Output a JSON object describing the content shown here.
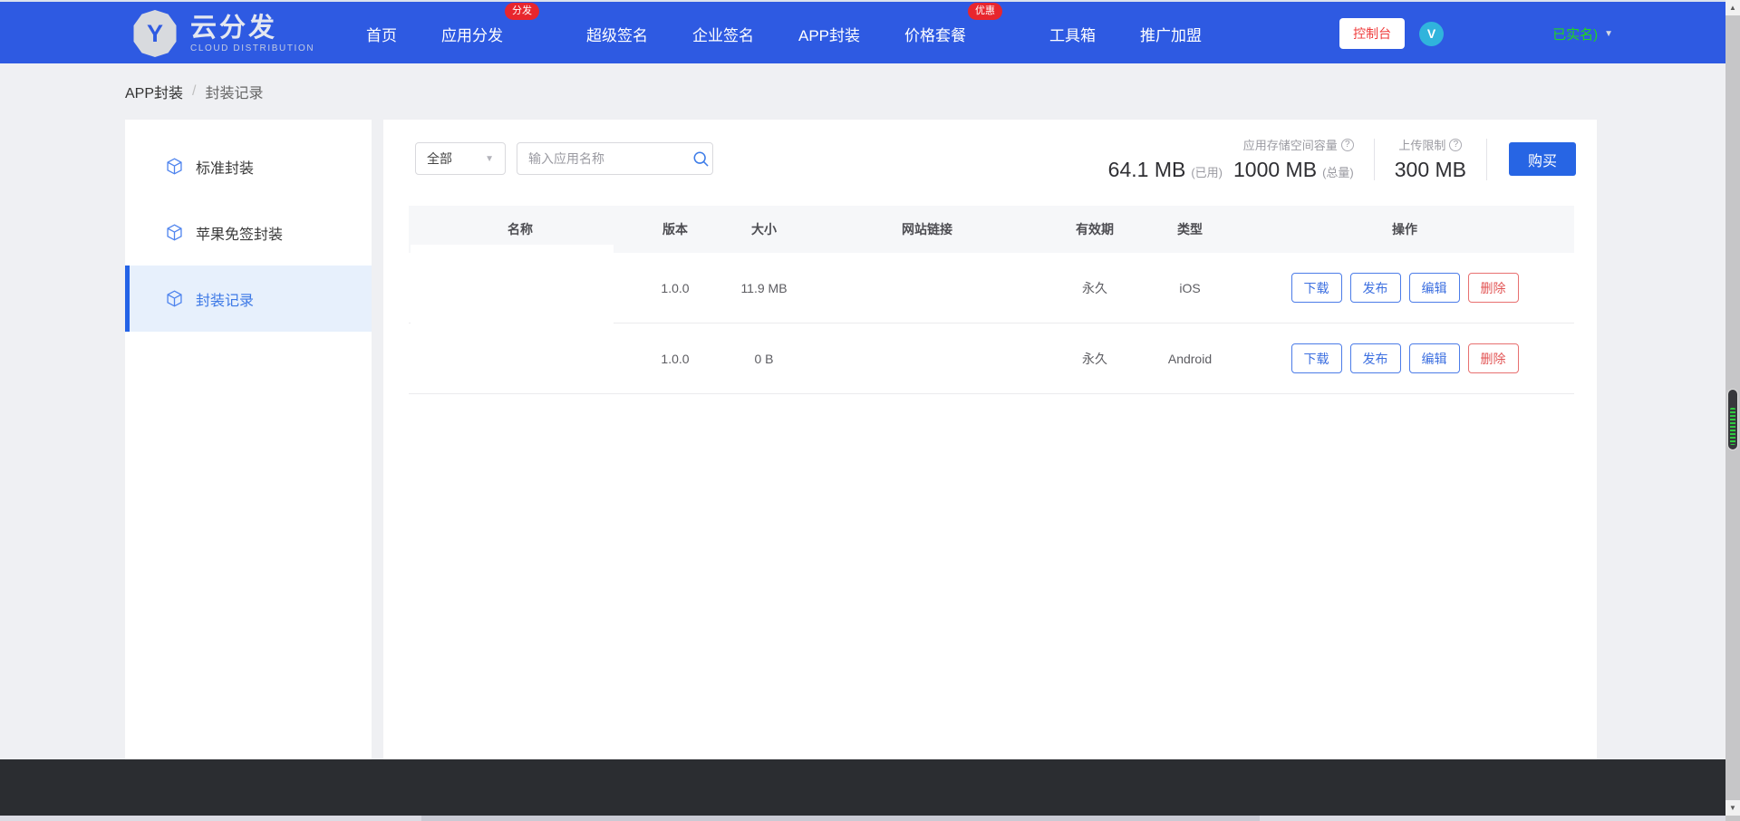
{
  "nav": {
    "logo": {
      "letter": "Y",
      "title": "云分发",
      "subtitle": "CLOUD DISTRIBUTION"
    },
    "items": [
      {
        "label": "首页"
      },
      {
        "label": "应用分发",
        "badge": "分发"
      },
      {
        "label": "超级签名"
      },
      {
        "label": "企业签名"
      },
      {
        "label": "APP封装"
      },
      {
        "label": "价格套餐",
        "badge": "优惠"
      },
      {
        "label": "工具箱"
      },
      {
        "label": "推广加盟"
      }
    ],
    "console_button": "控制台",
    "avatar_letter": "V",
    "account_status": "已实名)",
    "account_caret": "▼"
  },
  "breadcrumb": {
    "section": "APP封装",
    "separator": "/",
    "current": "封装记录"
  },
  "sidebar": {
    "items": [
      {
        "label": "标准封装"
      },
      {
        "label": "苹果免签封装"
      },
      {
        "label": "封装记录"
      }
    ]
  },
  "toolbar": {
    "filter_value": "全部",
    "filter_caret": "▼",
    "search_placeholder": "输入应用名称"
  },
  "storage": {
    "capacity_label": "应用存储空间容量",
    "used_value": "64.1 MB",
    "used_label": "(已用)",
    "total_value": "1000 MB",
    "total_label": "(总量)",
    "upload_label": "上传限制",
    "upload_value": "300 MB",
    "help_mark": "?",
    "buy_button": "购买"
  },
  "table": {
    "columns": [
      "名称",
      "版本",
      "大小",
      "网站链接",
      "有效期",
      "类型",
      "操作"
    ],
    "rows": [
      {
        "name": "",
        "version": "1.0.0",
        "size": "11.9 MB",
        "link": "",
        "validity": "永久",
        "type": "iOS"
      },
      {
        "name": "",
        "version": "1.0.0",
        "size": "0 B",
        "link": "",
        "validity": "永久",
        "type": "Android"
      }
    ],
    "actions": [
      "下载",
      "发布",
      "编辑",
      "删除"
    ]
  },
  "colors": {
    "navbar_blue": "#2e5ae2",
    "badge_red": "#e8262d",
    "accent_blue": "#2765e4",
    "success_green": "#22d422",
    "danger_red": "#e25555"
  }
}
